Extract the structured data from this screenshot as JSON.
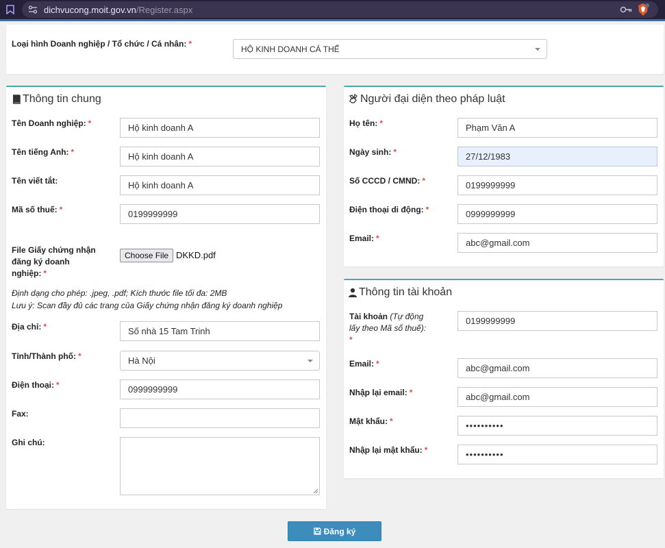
{
  "browser": {
    "url_domain": "dichvucong.moit.gov.vn",
    "url_path": "/Register.aspx"
  },
  "business_type": {
    "label": "Loại hình Doanh nghiệp / Tổ chức / Cá nhân:",
    "value": "HỘ KINH DOANH CÁ THỂ"
  },
  "general_info": {
    "title": "Thông tin chung",
    "company_name": {
      "label": "Tên Doanh nghiệp:",
      "value": "Hộ kinh doanh A"
    },
    "english_name": {
      "label": "Tên tiếng Anh:",
      "value": "Hộ kinh doanh A"
    },
    "short_name": {
      "label": "Tên viết tắt:",
      "value": "Hộ kinh doanh A"
    },
    "tax_code": {
      "label": "Mã số thuế:",
      "value": "0199999999"
    },
    "certificate_file": {
      "label_line1": "File Giấy chứng nhận",
      "label_line2": "đăng ký doanh",
      "label_line3": "nghiệp:",
      "button_label": "Choose File",
      "file_name": "DKKD.pdf"
    },
    "note_line1": "Định dạng cho phép: .jpeg, .pdf; Kích thước file tối đa: 2MB",
    "note_line2": "Lưu ý: Scan đầy đủ các trang của Giấy chứng nhận đăng ký doanh nghiệp",
    "address": {
      "label": "Địa chỉ:",
      "value": "Số nhà 15 Tam Trinh"
    },
    "province": {
      "label": "Tỉnh/Thành phố:",
      "value": "Hà Nội"
    },
    "phone": {
      "label": "Điện thoại:",
      "value": "0999999999"
    },
    "fax": {
      "label": "Fax:",
      "value": ""
    },
    "notes": {
      "label": "Ghi chú:",
      "value": ""
    }
  },
  "legal_rep": {
    "title": "Người đại diện theo pháp luật",
    "full_name": {
      "label": "Họ tên:",
      "value": "Phạm Văn A"
    },
    "birth_date": {
      "label": "Ngày sinh:",
      "value": "27/12/1983"
    },
    "id_number": {
      "label": "Số CCCD / CMND:",
      "value": "0199999999"
    },
    "mobile": {
      "label": "Điện thoại di động:",
      "value": "0999999999"
    },
    "email": {
      "label": "Email:",
      "value": "abc@gmail.com"
    }
  },
  "account": {
    "title": "Thông tin tài khoản",
    "username": {
      "label_bold": "Tài khoản",
      "label_italic_line1": "(Tự động",
      "label_italic_line2": "lấy theo Mã số thuế):",
      "value": "0199999999"
    },
    "email": {
      "label": "Email:",
      "value": "abc@gmail.com"
    },
    "email_confirm": {
      "label": "Nhập lại email:",
      "value": "abc@gmail.com"
    },
    "password": {
      "label": "Mật khẩu:",
      "value": "••••••••••"
    },
    "password_confirm": {
      "label": "Nhập lại mật khẩu:",
      "value": "••••••••••"
    }
  },
  "submit": {
    "label": "Đăng ký"
  },
  "required_marker": "*",
  "colors": {
    "accent": "#3c8dbc",
    "required": "#d9534f",
    "panel_top": "#4aa8a8"
  }
}
